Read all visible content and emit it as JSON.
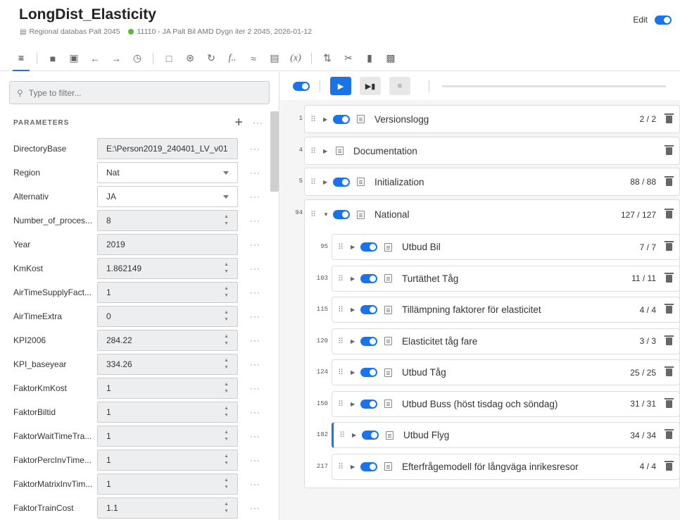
{
  "header": {
    "title": "LongDist_Elasticity",
    "database": "Regional databas Palt 2045",
    "scenario": "11110 - JA Palt Bil AMD Dygn iter 2 2045, 2026-01-12",
    "edit_label": "Edit",
    "edit_enabled": true
  },
  "filter": {
    "placeholder": "Type to filter..."
  },
  "parameters": {
    "title": "PARAMETERS",
    "items": [
      {
        "name": "DirectoryBase",
        "value": "E:\\Person2019_240401_LV_v01",
        "type": "text"
      },
      {
        "name": "Region",
        "value": "Nat",
        "type": "select"
      },
      {
        "name": "Alternativ",
        "value": "JA",
        "type": "select"
      },
      {
        "name": "Number_of_proces...",
        "value": "8",
        "type": "number"
      },
      {
        "name": "Year",
        "value": "2019",
        "type": "text"
      },
      {
        "name": "KmKost",
        "value": "1.862149",
        "type": "number"
      },
      {
        "name": "AirTimeSupplyFact...",
        "value": "1",
        "type": "number"
      },
      {
        "name": "AirTimeExtra",
        "value": "0",
        "type": "number"
      },
      {
        "name": "KPI2006",
        "value": "284.22",
        "type": "number"
      },
      {
        "name": "KPI_baseyear",
        "value": "334.26",
        "type": "number"
      },
      {
        "name": "FaktorKmKost",
        "value": "1",
        "type": "number"
      },
      {
        "name": "FaktorBiltid",
        "value": "1",
        "type": "number"
      },
      {
        "name": "FaktorWaitTimeTra...",
        "value": "1",
        "type": "number"
      },
      {
        "name": "FaktorPercInvTime...",
        "value": "1",
        "type": "number"
      },
      {
        "name": "FaktorMatrixInvTim...",
        "value": "1",
        "type": "number"
      },
      {
        "name": "FaktorTrainCost",
        "value": "1.1",
        "type": "number"
      }
    ]
  },
  "blocks": [
    {
      "line": "1",
      "label": "Versionslogg",
      "count": "2 / 2",
      "has_toggle": true
    },
    {
      "line": "4",
      "label": "Documentation",
      "count": "",
      "has_toggle": false
    },
    {
      "line": "5",
      "label": "Initialization",
      "count": "88 / 88",
      "has_toggle": true
    },
    {
      "line": "94",
      "label": "National",
      "count": "127 / 127",
      "has_toggle": true
    }
  ],
  "subblocks": [
    {
      "line": "95",
      "label": "Utbud Bil",
      "count": "7 / 7"
    },
    {
      "line": "103",
      "label": "Turtäthet Tåg",
      "count": "11 / 11"
    },
    {
      "line": "115",
      "label": "Tillämpning faktorer för elasticitet",
      "count": "4 / 4"
    },
    {
      "line": "120",
      "label": "Elasticitet tåg fare",
      "count": "3 / 3"
    },
    {
      "line": "124",
      "label": "Utbud Tåg",
      "count": "25 / 25"
    },
    {
      "line": "150",
      "label": "Utbud Buss (höst tisdag och söndag)",
      "count": "31 / 31"
    },
    {
      "line": "182",
      "label": "Utbud Flyg",
      "count": "34 / 34"
    },
    {
      "line": "217",
      "label": "Efterfrågemodell för långväga inrikesresor",
      "count": "4 / 4"
    }
  ],
  "colors": {
    "accent": "#1a73e8",
    "status_ok": "#55bb33"
  }
}
